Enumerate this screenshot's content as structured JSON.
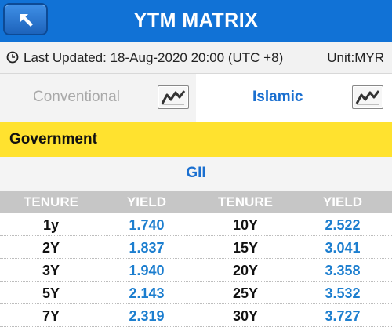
{
  "header": {
    "title": "YTM MATRIX",
    "back_icon": "back-arrow-icon"
  },
  "info": {
    "last_updated": "Last Updated: 18-Aug-2020 20:00 (UTC +8)",
    "unit": "Unit:MYR",
    "icon": "clock-icon"
  },
  "tabs": [
    {
      "label": "Conventional",
      "active": false,
      "icon": "line-chart-icon"
    },
    {
      "label": "Islamic",
      "active": true,
      "icon": "line-chart-icon"
    }
  ],
  "section": {
    "label": "Government"
  },
  "subheader": {
    "label": "GII"
  },
  "columns": [
    "TENURE",
    "YIELD",
    "TENURE",
    "YIELD"
  ],
  "rows": [
    [
      "1y",
      "1.740",
      "10Y",
      "2.522"
    ],
    [
      "2Y",
      "1.837",
      "15Y",
      "3.041"
    ],
    [
      "3Y",
      "1.940",
      "20Y",
      "3.358"
    ],
    [
      "5Y",
      "2.143",
      "25Y",
      "3.532"
    ],
    [
      "7Y",
      "2.319",
      "30Y",
      "3.727"
    ]
  ],
  "colors": {
    "header_bg": "#1172d6",
    "section_bg": "#ffe22f",
    "accent_text": "#1a6fd0",
    "yield_text": "#1c7ecf",
    "column_header_bg": "#c6c6c6"
  }
}
